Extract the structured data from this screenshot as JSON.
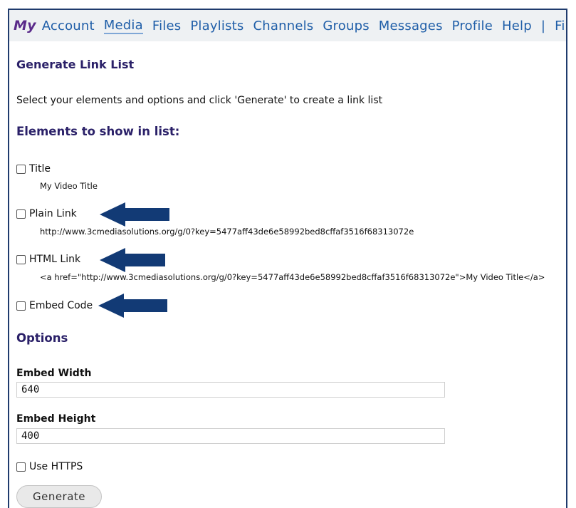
{
  "nav": {
    "my": "My",
    "items": [
      "Account",
      "Media",
      "Files",
      "Playlists",
      "Channels",
      "Groups",
      "Messages",
      "Profile",
      "Help"
    ],
    "separator": "|",
    "trailing": "File"
  },
  "page": {
    "title": "Generate Link List",
    "intro": "Select your elements and options and click 'Generate' to create a link list",
    "elements_heading": "Elements to show in list:",
    "options_heading": "Options"
  },
  "elements": {
    "title": {
      "label": "Title",
      "preview": "My Video Title"
    },
    "plain_link": {
      "label": "Plain Link",
      "preview": "http://www.3cmediasolutions.org/g/0?key=5477aff43de6e58992bed8cffaf3516f68313072e"
    },
    "html_link": {
      "label": "HTML Link",
      "preview": "<a href=\"http://www.3cmediasolutions.org/g/0?key=5477aff43de6e58992bed8cffaf3516f68313072e\">My Video Title</a>"
    },
    "embed_code": {
      "label": "Embed Code"
    }
  },
  "options": {
    "embed_width_label": "Embed Width",
    "embed_width_value": "640",
    "embed_height_label": "Embed Height",
    "embed_height_value": "400",
    "use_https_label": "Use HTTPS"
  },
  "generate_label": "Generate",
  "colors": {
    "arrow": "#123a75",
    "heading": "#2a2068",
    "nav_link": "#1f5ea8",
    "nav_bg": "#eef1f3"
  }
}
